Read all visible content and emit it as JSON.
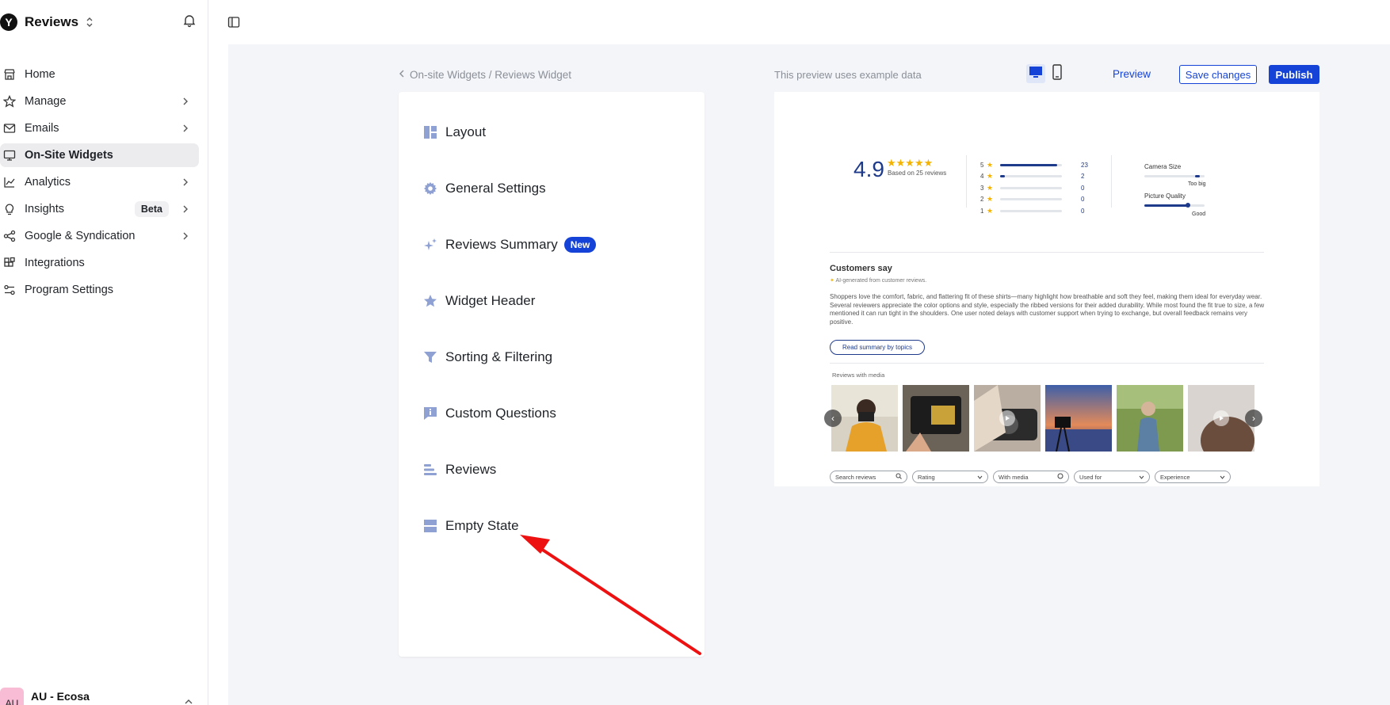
{
  "app": {
    "brand_initial": "Y",
    "brand_name": "Reviews"
  },
  "sidebar": {
    "items": [
      {
        "label": "Home",
        "icon": "store-icon",
        "chevron": false
      },
      {
        "label": "Manage",
        "icon": "star-icon",
        "chevron": true
      },
      {
        "label": "Emails",
        "icon": "mail-icon",
        "chevron": true
      },
      {
        "label": "On-Site Widgets",
        "icon": "monitor-icon",
        "chevron": false,
        "active": true
      },
      {
        "label": "Analytics",
        "icon": "chart-line-icon",
        "chevron": true
      },
      {
        "label": "Insights",
        "icon": "lightbulb-icon",
        "chevron": true,
        "badge": "Beta"
      },
      {
        "label": "Google & Syndication",
        "icon": "share-icon",
        "chevron": true
      },
      {
        "label": "Integrations",
        "icon": "blocks-icon",
        "chevron": false
      },
      {
        "label": "Program Settings",
        "icon": "sliders-icon",
        "chevron": false
      }
    ],
    "account": {
      "initials": "AU",
      "name": "AU - Ecosa"
    }
  },
  "breadcrumb": "On-site Widgets / Reviews Widget",
  "settings_menu": [
    {
      "label": "Layout",
      "icon": "layout-icon"
    },
    {
      "label": "General Settings",
      "icon": "gear-icon"
    },
    {
      "label": "Reviews Summary",
      "icon": "sparkle-icon",
      "badge": "New"
    },
    {
      "label": "Widget Header",
      "icon": "star-icon"
    },
    {
      "label": "Sorting & Filtering",
      "icon": "funnel-icon"
    },
    {
      "label": "Custom Questions",
      "icon": "info-chat-icon"
    },
    {
      "label": "Reviews",
      "icon": "list-icon"
    },
    {
      "label": "Empty State",
      "icon": "rows-icon"
    }
  ],
  "preview": {
    "note": "This preview uses example data",
    "preview_label": "Preview",
    "save_label": "Save changes",
    "publish_label": "Publish",
    "accent": "#1543d8",
    "widget": {
      "rating": "4.9",
      "stars": "★★★★★",
      "based_on": "Based on 25 reviews",
      "distribution": [
        {
          "star": "5",
          "count": "23",
          "share": 0.92
        },
        {
          "star": "4",
          "count": "2",
          "share": 0.08
        },
        {
          "star": "3",
          "count": "0",
          "share": 0
        },
        {
          "star": "2",
          "count": "0",
          "share": 0
        },
        {
          "star": "1",
          "count": "0",
          "share": 0
        }
      ],
      "attributes": [
        {
          "name": "Camera Size",
          "value_label": "Too big",
          "level": 0.92
        },
        {
          "name": "Picture Quality",
          "value_label": "Good",
          "level": 0.72
        }
      ],
      "customers_say_title": "Customers say",
      "ai_note": "AI-generated from customer reviews.",
      "summary": "Shoppers love the comfort, fabric, and flattering fit of these shirts—many highlight how breathable and soft they feel, making them ideal for everyday wear. Several reviewers appreciate the color options and style, especially the ribbed versions for their added durability. While most found the fit true to size, a few mentioned it can run tight in the shoulders. One user noted delays with customer support when trying to exchange, but overall feedback remains very positive.",
      "topics_button": "Read summary by topics",
      "media_label": "Reviews with media",
      "filters": [
        {
          "label": "Search reviews",
          "icon": "search-icon"
        },
        {
          "label": "Rating",
          "icon": "chevron-down-icon"
        },
        {
          "label": "With media",
          "icon": "radio-icon"
        },
        {
          "label": "Used for",
          "icon": "chevron-down-icon"
        },
        {
          "label": "Experience",
          "icon": "chevron-down-icon"
        }
      ]
    }
  }
}
